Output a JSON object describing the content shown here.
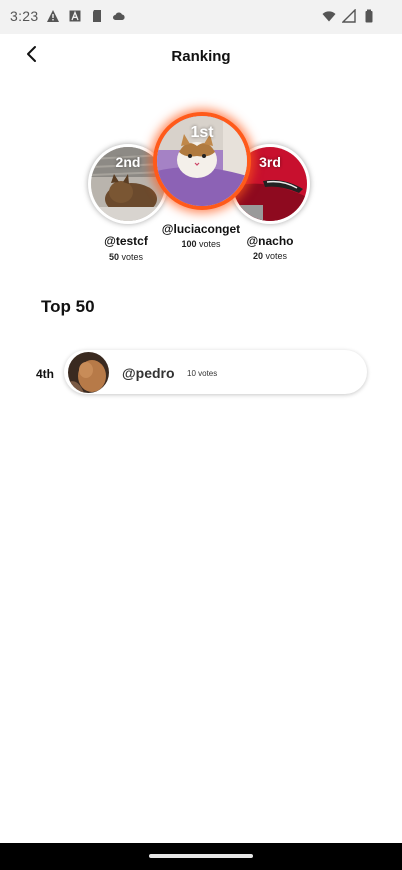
{
  "status_bar": {
    "time": "3:23",
    "left_icons": [
      "warning-icon",
      "text-a-icon",
      "sd-card-icon",
      "cloud-icon"
    ],
    "right_icons": [
      "wifi-icon",
      "cell-signal-icon",
      "battery-icon"
    ]
  },
  "header": {
    "title": "Ranking",
    "back_icon": "chevron-left-icon"
  },
  "podium": {
    "first": {
      "rank": "1st",
      "username": "@luciaconget",
      "votes_count": "100",
      "votes_word": "votes",
      "accent": "#ff5a1a"
    },
    "second": {
      "rank": "2nd",
      "username": "@testcf",
      "votes_count": "50",
      "votes_word": "votes"
    },
    "third": {
      "rank": "3rd",
      "username": "@nacho",
      "votes_count": "20",
      "votes_word": "votes"
    }
  },
  "top50": {
    "title": "Top 50",
    "items": [
      {
        "position": "4th",
        "username": "@pedro",
        "votes": "10 votes"
      }
    ]
  },
  "colors": {
    "accent": "#ff5a1a",
    "status_bar_bg": "#f2f2f2",
    "nav_bar_bg": "#000000"
  }
}
